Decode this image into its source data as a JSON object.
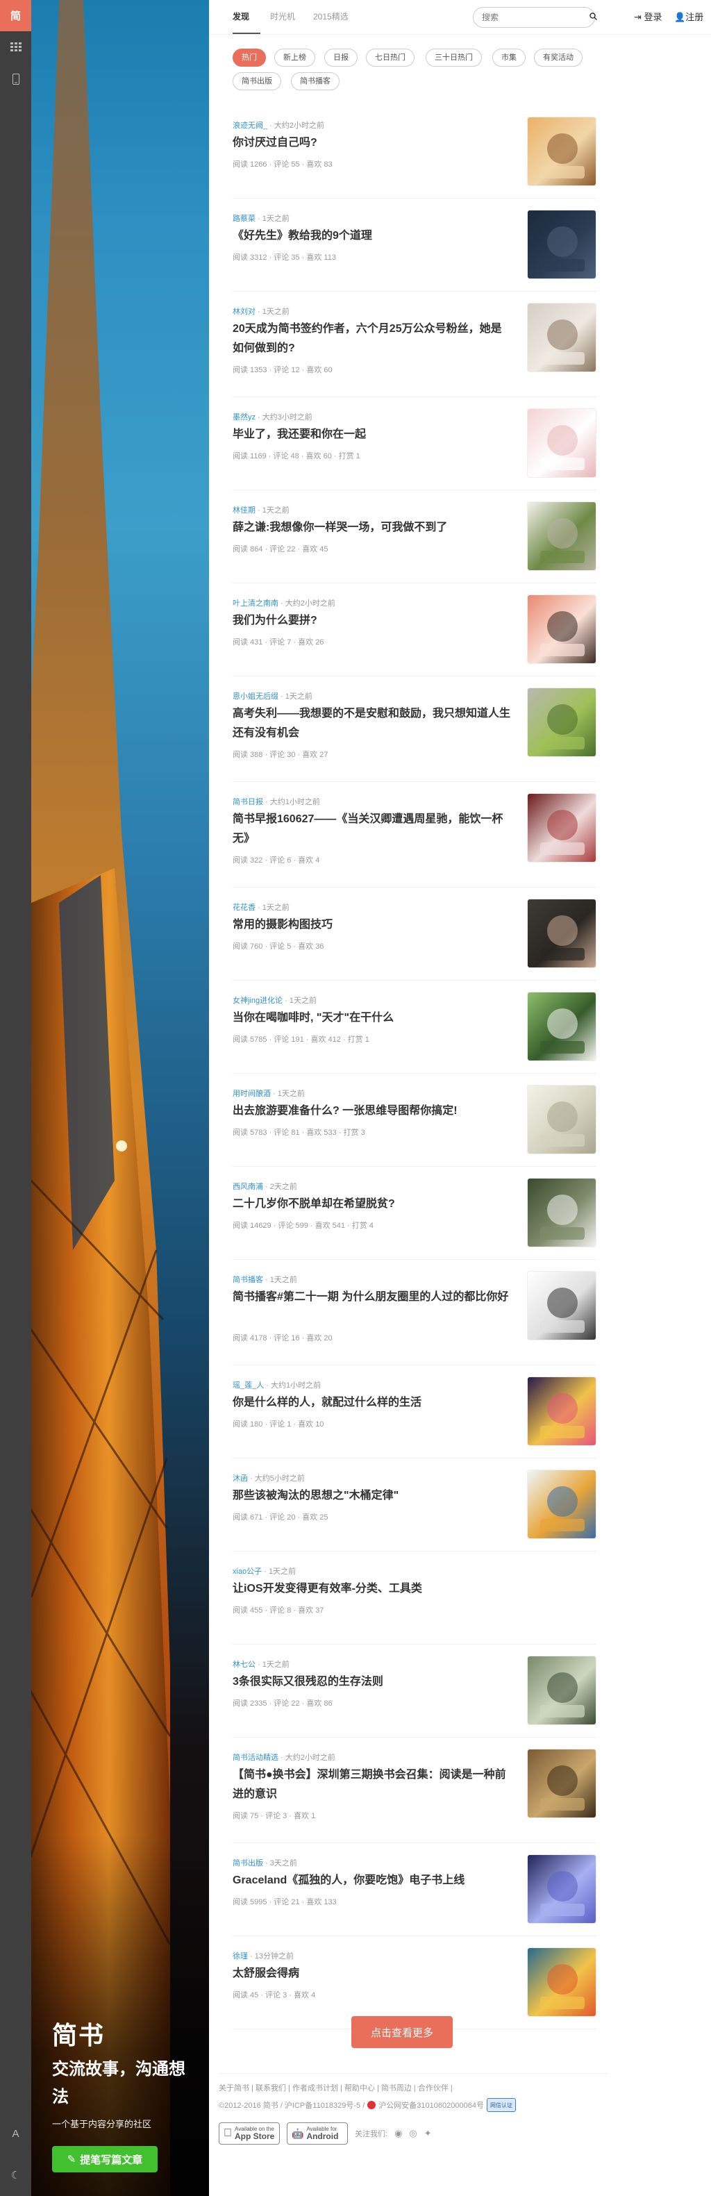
{
  "rail": {
    "logo": "简",
    "icons": [
      "grid-icon",
      "phone-icon"
    ],
    "bottom_icons": [
      "font-icon",
      "moon-icon"
    ]
  },
  "hero": {
    "brand": "简书",
    "slogan": "交流故事，沟通想法",
    "subtitle": "一个基于内容分享的社区",
    "write_button": "提笔写篇文章"
  },
  "nav": {
    "tabs": [
      "发现",
      "时光机",
      "2015精选"
    ],
    "search_placeholder": "搜索",
    "login": "登录",
    "register": "注册"
  },
  "categories": [
    "热门",
    "新上榜",
    "日报",
    "七日热门",
    "三十日热门",
    "市集",
    "有奖活动",
    "简书出版",
    "简书播客"
  ],
  "articles": [
    {
      "author": "浪迹无阙_",
      "time": "大约2小时之前",
      "title": "你讨厌过自己吗?",
      "stats": "阅读 1266 · 评论 55 · 喜欢 83"
    },
    {
      "author": "路蔡菜",
      "time": "1天之前",
      "title": "《好先生》教给我的9个道理",
      "stats": "阅读 3312 · 评论 35 · 喜欢 113"
    },
    {
      "author": "林刘对",
      "time": "1天之前",
      "title": "20天成为简书签约作者，六个月25万公众号粉丝，她是如何做到的?",
      "stats": "阅读 1353 · 评论 12 · 喜欢 60"
    },
    {
      "author": "墨然yz",
      "time": "大约3小时之前",
      "title": "毕业了，我还要和你在一起",
      "stats": "阅读 1169 · 评论 48 · 喜欢 60 · 打赏 1"
    },
    {
      "author": "林佳期",
      "time": "1天之前",
      "title": "薛之谦:我想像你一样哭一场，可我做不到了",
      "stats": "阅读 864 · 评论 22 · 喜欢 45"
    },
    {
      "author": "叶上清之南南",
      "time": "大约2小时之前",
      "title": "我们为什么要拼?",
      "stats": "阅读 431 · 评论 7 · 喜欢 26"
    },
    {
      "author": "恩小姐无后缀",
      "time": "1天之前",
      "title": "高考失利——我想要的不是安慰和鼓励，我只想知道人生还有没有机会",
      "stats": "阅读 388 · 评论 30 · 喜欢 27"
    },
    {
      "author": "简书日报",
      "time": "大约1小时之前",
      "title": "简书早报160627——《当关汉卿遭遇周星驰，能饮一杯无》",
      "stats": "阅读 322 · 评论 6 · 喜欢 4"
    },
    {
      "author": "花花香",
      "time": "1天之前",
      "title": "常用的摄影构图技巧",
      "stats": "阅读 760 · 评论 5 · 喜欢 36"
    },
    {
      "author": "女神jing进化论",
      "time": "1天之前",
      "title": "当你在喝咖啡时, \"天才\"在干什么",
      "stats": "阅读 5785 · 评论 191 · 喜欢 412 · 打赏 1"
    },
    {
      "author": "用时间酿酒",
      "time": "1天之前",
      "title": "出去旅游要准备什么? 一张思维导图帮你搞定!",
      "stats": "阅读 5783 · 评论 81 · 喜欢 533 · 打赏 3"
    },
    {
      "author": "西风南浦",
      "time": "2天之前",
      "title": "二十几岁你不脱单却在希望脱贫?",
      "stats": "阅读 14629 · 评论 599 · 喜欢 541 · 打赏 4"
    },
    {
      "author": "简书播客",
      "time": "1天之前",
      "title": "简书播客#第二十一期 为什么朋友圈里的人过的都比你好",
      "stats": "阅读 4178 · 评论 16 · 喜欢 20"
    },
    {
      "author": "瑶_莲_人",
      "time": "大约1小时之前",
      "title": "你是什么样的人，就配过什么样的生活",
      "stats": "阅读 180 · 评论 1 · 喜欢 10"
    },
    {
      "author": "沐函",
      "time": "大约5小时之前",
      "title": "那些该被淘汰的思想之\"木桶定律\"",
      "stats": "阅读 671 · 评论 20 · 喜欢 25"
    },
    {
      "author": "xiao公子",
      "time": "1天之前",
      "title": "让iOS开发变得更有效率-分类、工具类",
      "stats": "阅读 455 · 评论 8 · 喜欢 37"
    },
    {
      "author": "林七公",
      "time": "1天之前",
      "title": "3条很实际又很残忍的生存法则",
      "stats": "阅读 2335 · 评论 22 · 喜欢 86"
    },
    {
      "author": "简书活动精选",
      "time": "大约2小时之前",
      "title": "【简书●换书会】深圳第三期换书会召集：阅读是一种前进的意识",
      "stats": "阅读 75 · 评论 3 · 喜欢 1"
    },
    {
      "author": "简书出版",
      "time": "3天之前",
      "title": "Graceland《孤独的人，你要吃饱》电子书上线",
      "stats": "阅读 5995 · 评论 21 · 喜欢 133"
    },
    {
      "author": "徐瑾",
      "time": "13分钟之前",
      "title": "太舒服会得病",
      "stats": "阅读 45 · 评论 3 · 喜欢 4"
    }
  ],
  "load_more": "点击查看更多",
  "footer": {
    "links": "关于简书 | 联系我们 | 作者成书计划 | 帮助中心 | 简书周边 | 合作伙伴 |",
    "copyright": "©2012-2016 简书 / 沪ICP备11018329号-5 /",
    "police": "沪公网安备31010602000064号",
    "badge": "网信认证",
    "app_store_small": "Available on the",
    "app_store": "App Store",
    "android_small": "Available for",
    "android": "Android",
    "follow": "关注我们:"
  },
  "colors": {
    "accent": "#ea6f5a",
    "green": "#42c02e",
    "link": "#3194d0"
  }
}
